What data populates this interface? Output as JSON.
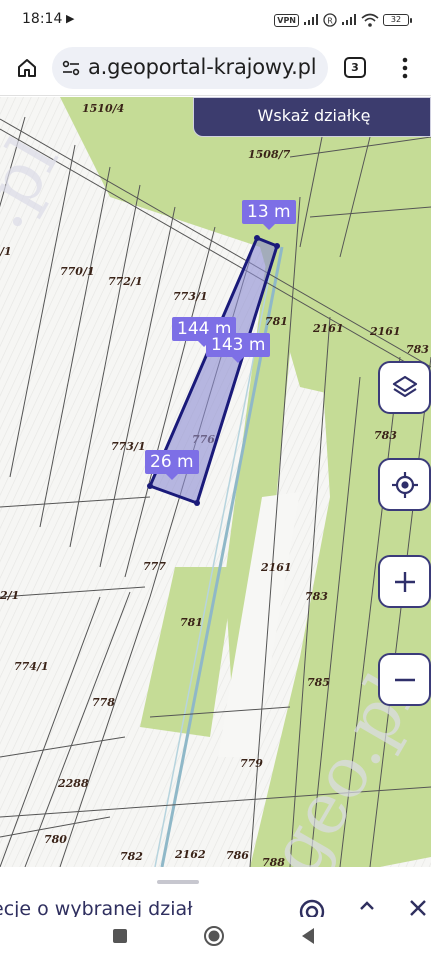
{
  "status_bar": {
    "time": "18:14",
    "play_icon": "play-icon",
    "vpn": "VPN",
    "roaming": "R",
    "battery": "32"
  },
  "browser": {
    "url": "a.geoportal-krajowy.pl",
    "tab_count": "3",
    "icons": [
      "home-icon",
      "site-settings-icon",
      "overflow-menu-icon"
    ]
  },
  "map": {
    "point_button_label": "Wskaż działkę",
    "measurements": [
      "13 m",
      "144 m",
      "143 m",
      "26 m"
    ],
    "parcels": [
      "1510/4",
      "1508/7",
      "770/1",
      "772/1",
      "773/1",
      "781",
      "2161",
      "2161",
      "783",
      "776",
      "773/1",
      "783",
      "777",
      "2161",
      "781",
      "783",
      "774/1",
      "778",
      "785",
      "779",
      "2288",
      "780",
      "782",
      "2162",
      "786",
      "788",
      "/1",
      "2/1"
    ],
    "watermarks": [
      ".pl",
      "geo.pl"
    ],
    "colors": {
      "plot_fill": "#c5dc96",
      "selection_stroke": "#1a1a7a",
      "selection_fill": "#8c8cd2",
      "label_bg": "#7d6fe6",
      "control_border": "#3b3b7a"
    },
    "controls": [
      "layers-icon",
      "my-location-icon",
      "zoom-in-icon",
      "zoom-out-icon"
    ]
  },
  "bottom_sheet": {
    "text": "ecje o wybranej dział",
    "icons": [
      "target-icon",
      "chevron-up-icon",
      "close-icon"
    ]
  },
  "nav_bar": {
    "icons": [
      "recent-apps-icon",
      "home-circle-icon",
      "back-icon"
    ]
  }
}
